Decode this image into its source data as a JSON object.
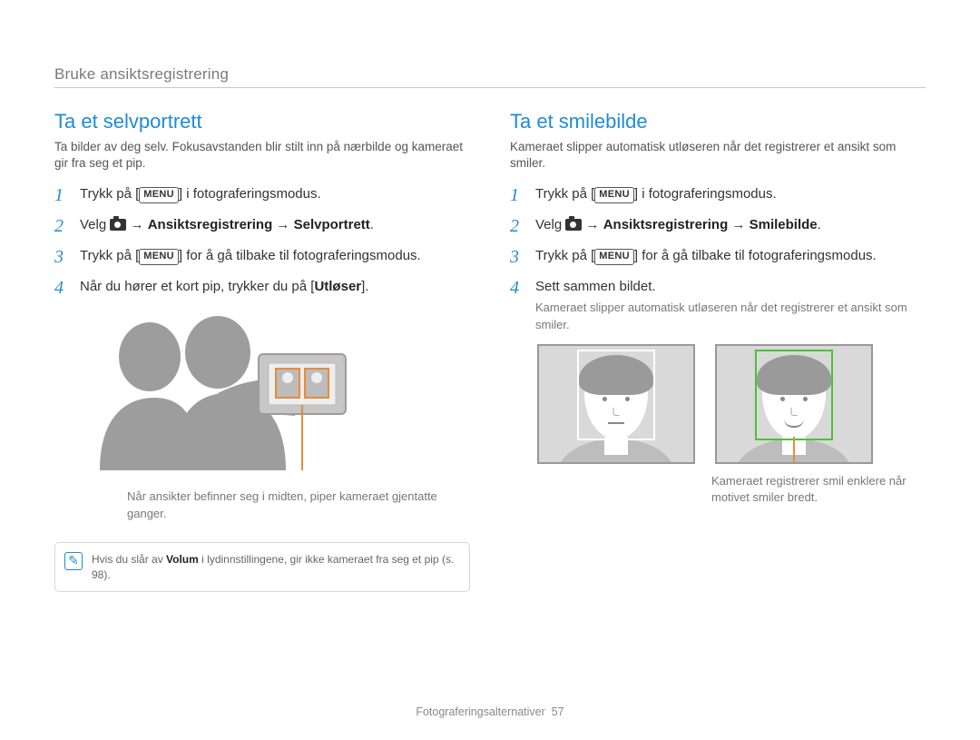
{
  "breadcrumb": "Bruke ansiktsregistrering",
  "left": {
    "title": "Ta et selvportrett",
    "intro": "Ta bilder av deg selv. Fokusavstanden blir stilt inn på nærbilde og kameraet gir fra seg et pip.",
    "step1_pre": "Trykk på [",
    "step1_chip": "MENU",
    "step1_post": "] i fotograferingsmodus.",
    "step2_pre": "Velg ",
    "step2_arrow": " → ",
    "step2_b1": "Ansiktsregistrering",
    "step2_b2": "Selvportrett",
    "step3_pre": "Trykk på [",
    "step3_chip": "MENU",
    "step3_post": "] for å gå tilbake til fotograferingsmodus.",
    "step4_pre": "Når du hører et kort pip, trykker du på [",
    "step4_b": "Utløser",
    "step4_post": "].",
    "caption": "Når ansikter befinner seg i midten, piper kameraet gjentatte ganger.",
    "note_pre": "Hvis du slår av ",
    "note_b": "Volum",
    "note_post": " i lydinnstillingene, gir ikke kameraet fra seg et pip (s. 98)."
  },
  "right": {
    "title": "Ta et smilebilde",
    "intro": "Kameraet slipper automatisk utløseren når det registrerer et ansikt som smiler.",
    "step1_pre": "Trykk på [",
    "step1_chip": "MENU",
    "step1_post": "] i fotograferingsmodus.",
    "step2_pre": "Velg ",
    "step2_arrow": " → ",
    "step2_b1": "Ansiktsregistrering",
    "step2_b2": "Smilebilde",
    "step3_pre": "Trykk på [",
    "step3_chip": "MENU",
    "step3_post": "] for å gå tilbake til fotograferingsmodus.",
    "step4": "Sett sammen bildet.",
    "step4_sub": "Kameraet slipper automatisk utløseren når det registrerer et ansikt som smiler.",
    "caption": "Kameraet registrerer smil enklere når motivet smiler bredt."
  },
  "footer_label": "Fotograferingsalternativer",
  "page_number": "57"
}
